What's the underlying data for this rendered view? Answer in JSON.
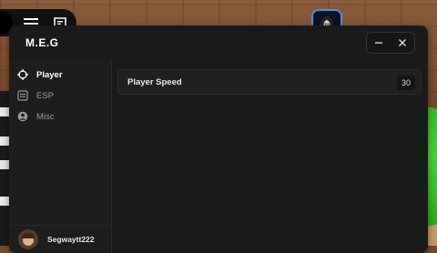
{
  "app": {
    "title": "M.E.G"
  },
  "nav": {
    "items": [
      {
        "label": "Player",
        "icon": "crosshair-icon",
        "active": true
      },
      {
        "label": "ESP",
        "icon": "list-icon",
        "active": false
      },
      {
        "label": "Misc",
        "icon": "user-circle-icon",
        "active": false
      }
    ]
  },
  "user": {
    "name": "Segwaytt222"
  },
  "settings": {
    "player_speed": {
      "label": "Player Speed",
      "value": "30"
    }
  },
  "colors": {
    "window_bg": "#1a1a1a",
    "sidebar_bg": "#1d1d1d",
    "accent_blue": "#4a90e2",
    "text_active": "#ffffff",
    "text_inactive": "#9a9a9a"
  }
}
